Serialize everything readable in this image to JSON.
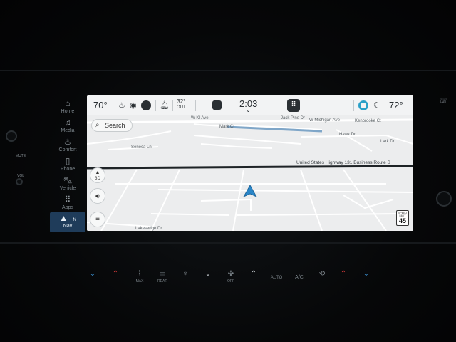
{
  "side_nav": {
    "items": [
      {
        "label": "Home",
        "icon": "home-icon",
        "glyph": "⌂"
      },
      {
        "label": "Media",
        "icon": "music-note-icon",
        "glyph": "♫"
      },
      {
        "label": "Comfort",
        "icon": "seat-comfort-icon",
        "glyph": "♨"
      },
      {
        "label": "Phone",
        "icon": "phone-icon",
        "glyph": "▯"
      },
      {
        "label": "Vehicle",
        "icon": "car-icon",
        "glyph": "⛍"
      },
      {
        "label": "Apps",
        "icon": "apps-grid-icon",
        "glyph": "⠿"
      },
      {
        "label": "Nav",
        "icon": "navigation-arrow-icon",
        "glyph": "▲"
      }
    ],
    "compass": "N"
  },
  "left_controls": {
    "mute_label": "MUTE",
    "vol_label": "VOL"
  },
  "status_bar": {
    "driver_temp": "70°",
    "outside_temp": "32°",
    "outside_label": "OUT",
    "time": "2:03",
    "passenger_temp": "72°"
  },
  "search": {
    "label": "Search"
  },
  "map": {
    "view_mode": "3D",
    "streets": [
      "W KI Ave",
      "Jack Pine Dr",
      "W Michigan Ave",
      "Kenbrooke Ct",
      "Mark Ct",
      "Seneca Ln",
      "Hawk Dr",
      "Lark Dr",
      "Lakesedge Dr"
    ],
    "route_name": "United States Highway 131 Business Route S"
  },
  "speed_limit": {
    "title": "SPEED LIMIT",
    "value": "45"
  },
  "climate": {
    "max_label": "MAX",
    "rear_label": "REAR",
    "off_label": "OFF",
    "auto_label": "AUTO",
    "ac_label": "A/C"
  },
  "colors": {
    "route_line": "#1e2326",
    "vehicle_arrow": "#2a86c8",
    "nav_active": "#1f3c5a",
    "temp_up": "#d83a3a",
    "temp_down": "#3a8fd0"
  }
}
